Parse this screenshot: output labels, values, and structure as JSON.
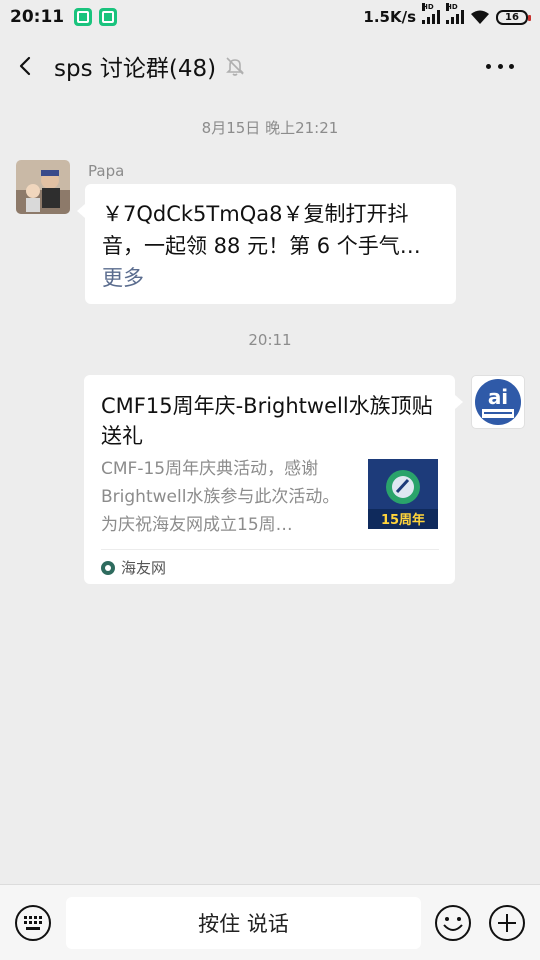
{
  "status_bar": {
    "time": "20:11",
    "net_speed": "1.5K/s",
    "signal_tag_1": "HD",
    "signal_tag_2": "HD",
    "battery": "16"
  },
  "header": {
    "title": "sps 讨论群(48)"
  },
  "chat": {
    "timestamp_1": "8月15日 晚上21:21",
    "timestamp_2": "20:11",
    "incoming": {
      "sender": "Papa",
      "text": "￥7QdCk5TmQa8￥复制打开抖音，一起领 88 元！第 6 个手气…",
      "more": "更多"
    },
    "card": {
      "title": "CMF15周年庆-Brightwell水族顶贴送礼",
      "description": "CMF-15周年庆典活动，感谢Brightwell水族参与此次活动。为庆祝海友网成立15周…",
      "thumb_text": "15周年",
      "source": "海友网"
    },
    "my_avatar_text": "ai"
  },
  "bottom_bar": {
    "hold_to_talk": "按住 说话"
  }
}
